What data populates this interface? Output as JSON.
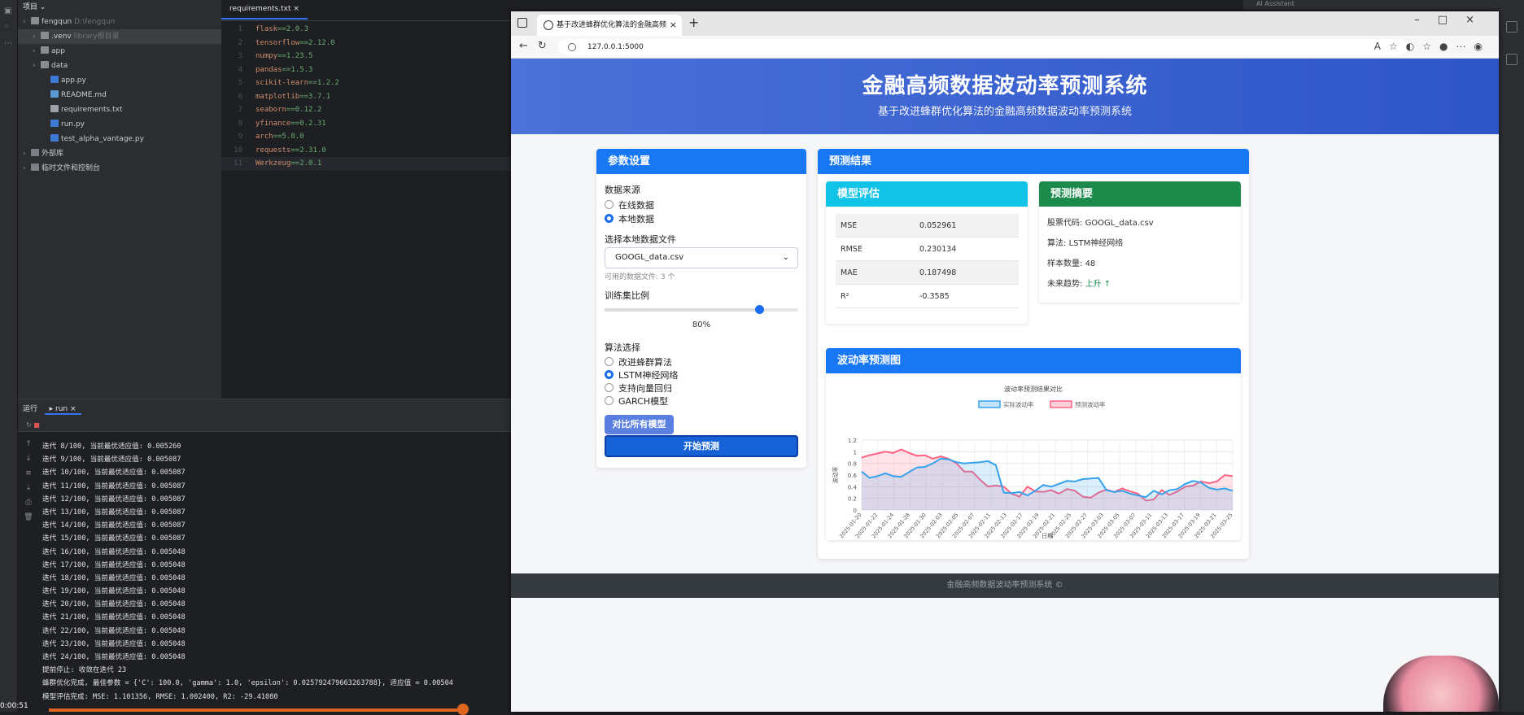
{
  "ide": {
    "project_header": "项目",
    "tree": [
      {
        "label": "fengqun",
        "hint": "D:\\fengqun",
        "indent": 0,
        "type": "folder"
      },
      {
        "label": ".venv",
        "hint": "library根目录",
        "indent": 1,
        "type": "folder",
        "selected": true
      },
      {
        "label": "app",
        "hint": "",
        "indent": 1,
        "type": "folder"
      },
      {
        "label": "data",
        "hint": "",
        "indent": 1,
        "type": "folder"
      },
      {
        "label": "app.py",
        "hint": "",
        "indent": 2,
        "type": "py"
      },
      {
        "label": "README.md",
        "hint": "",
        "indent": 2,
        "type": "md"
      },
      {
        "label": "requirements.txt",
        "hint": "",
        "indent": 2,
        "type": "txt"
      },
      {
        "label": "run.py",
        "hint": "",
        "indent": 2,
        "type": "py"
      },
      {
        "label": "test_alpha_vantage.py",
        "hint": "",
        "indent": 2,
        "type": "py"
      },
      {
        "label": "外部库",
        "hint": "",
        "indent": 0,
        "type": "lib"
      },
      {
        "label": "临时文件和控制台",
        "hint": "",
        "indent": 0,
        "type": "lib"
      }
    ],
    "editor_tab": "requirements.txt",
    "code": [
      {
        "n": "1",
        "pkg": "flask",
        "ver": "==2.0.3"
      },
      {
        "n": "2",
        "pkg": "tensorflow",
        "ver": "==2.12.0"
      },
      {
        "n": "3",
        "pkg": "numpy",
        "ver": "==1.23.5"
      },
      {
        "n": "4",
        "pkg": "pandas",
        "ver": "==1.5.3"
      },
      {
        "n": "5",
        "pkg": "scikit-learn",
        "ver": "==1.2.2"
      },
      {
        "n": "6",
        "pkg": "matplotlib",
        "ver": "==3.7.1"
      },
      {
        "n": "7",
        "pkg": "seaborn",
        "ver": "==0.12.2"
      },
      {
        "n": "8",
        "pkg": "yfinance",
        "ver": "==0.2.31"
      },
      {
        "n": "9",
        "pkg": "arch",
        "ver": "==5.0.0"
      },
      {
        "n": "10",
        "pkg": "requests",
        "ver": "==2.31.0"
      },
      {
        "n": "11",
        "pkg": "Werkzeug",
        "ver": "==2.0.1"
      }
    ],
    "run_header": "运行",
    "run_tab": "run",
    "console": [
      "迭代 8/100, 当前最优适应值: 0.005260",
      "迭代 9/100, 当前最优适应值: 0.005087",
      "迭代 10/100, 当前最优适应值: 0.005087",
      "迭代 11/100, 当前最优适应值: 0.005087",
      "迭代 12/100, 当前最优适应值: 0.005087",
      "迭代 13/100, 当前最优适应值: 0.005087",
      "迭代 14/100, 当前最优适应值: 0.005087",
      "迭代 15/100, 当前最优适应值: 0.005087",
      "迭代 16/100, 当前最优适应值: 0.005048",
      "迭代 17/100, 当前最优适应值: 0.005048",
      "迭代 18/100, 当前最优适应值: 0.005048",
      "迭代 19/100, 当前最优适应值: 0.005048",
      "迭代 20/100, 当前最优适应值: 0.005048",
      "迭代 21/100, 当前最优适应值: 0.005048",
      "迭代 22/100, 当前最优适应值: 0.005048",
      "迭代 23/100, 当前最优适应值: 0.005048",
      "迭代 24/100, 当前最优适应值: 0.005048",
      "提前停止: 收敛在迭代 23",
      "蜂群优化完成, 最佳参数 = {'C': 100.0, 'gamma': 1.0, 'epsilon': 0.025792479663263788}, 适应值 = 0.00504",
      "模型评估完成: MSE: 1.101356, RMSE: 1.002400, R2: -29.41080"
    ],
    "timestamp": "0:00:51",
    "top_right": "AI Assistant"
  },
  "browser": {
    "tab_title": "基于改进蜂群优化算法的金融高频",
    "url": "127.0.0.1:5000"
  },
  "page": {
    "title": "金融高频数据波动率预测系统",
    "subtitle": "基于改进蜂群优化算法的金融高频数据波动率预测系统",
    "params": {
      "header": "参数设置",
      "source_label": "数据来源",
      "source_online": "在线数据",
      "source_local": "本地数据",
      "file_label": "选择本地数据文件",
      "file_value": "GOOGL_data.csv",
      "file_hint": "可用的数据文件: 3 个",
      "ratio_label": "训练集比例",
      "ratio_value": "80%",
      "ratio_fraction": 0.8,
      "algo_label": "算法选择",
      "algos": [
        "改进蜂群算法",
        "LSTM神经网络",
        "支持向量回归",
        "GARCH模型"
      ],
      "selected_algo": 1,
      "compare_btn": "对比所有模型",
      "start_btn": "开始预测"
    },
    "results": {
      "header": "预测结果",
      "eval_header": "模型评估",
      "metrics": [
        {
          "k": "MSE",
          "v": "0.052961"
        },
        {
          "k": "RMSE",
          "v": "0.230134"
        },
        {
          "k": "MAE",
          "v": "0.187498"
        },
        {
          "k": "R²",
          "v": "-0.3585"
        }
      ],
      "summary_header": "预测摘要",
      "ticker_label": "股票代码: ",
      "ticker": "GOOGL_data.csv",
      "algo_label": "算法: ",
      "algo": "LSTM神经网络",
      "samples_label": "样本数量: ",
      "samples": "48",
      "trend_label": "未来趋势: ",
      "trend": "上升 ↑",
      "chart_header": "波动率预测图"
    },
    "footer": "金融高频数据波动率预测系统 ©"
  },
  "colors": {
    "actual": "#36a2eb",
    "predicted": "#ff6384",
    "accent": "#1877f2"
  },
  "chart_data": {
    "type": "area",
    "title": "波动率预测结果对比",
    "xlabel": "日期",
    "ylabel": "波动率",
    "ylim": [
      0,
      1.2
    ],
    "y_ticks": [
      "0",
      "0.2",
      "0.4",
      "0.6",
      "0.8",
      "1",
      "1.2"
    ],
    "legend_position": "top",
    "grid": true,
    "x_tick_labels": [
      "2025-01-20",
      "2025-01-22",
      "2025-01-24",
      "2025-01-28",
      "2025-01-30",
      "2025-02-03",
      "2025-02-05",
      "2025-02-07",
      "2025-02-11",
      "2025-02-13",
      "2025-02-17",
      "2025-02-19",
      "2025-02-21",
      "2025-02-25",
      "2025-02-27",
      "2025-03-03",
      "2025-03-05",
      "2025-03-07",
      "2025-03-11",
      "2025-03-13",
      "2025-03-17",
      "2025-03-19",
      "2025-03-21",
      "2025-03-25"
    ],
    "series": [
      {
        "name": "实际波动率",
        "color": "#36a2eb",
        "values": [
          0.66,
          0.55,
          0.58,
          0.63,
          0.58,
          0.57,
          0.65,
          0.73,
          0.74,
          0.8,
          0.88,
          0.87,
          0.82,
          0.8,
          0.81,
          0.82,
          0.84,
          0.77,
          0.3,
          0.29,
          0.31,
          0.25,
          0.33,
          0.43,
          0.4,
          0.45,
          0.5,
          0.49,
          0.53,
          0.54,
          0.55,
          0.34,
          0.31,
          0.33,
          0.28,
          0.25,
          0.22,
          0.33,
          0.27,
          0.34,
          0.36,
          0.45,
          0.5,
          0.47,
          0.38,
          0.35,
          0.37,
          0.33
        ]
      },
      {
        "name": "预测波动率",
        "color": "#ff6384",
        "values": [
          0.9,
          0.94,
          0.97,
          1.0,
          0.98,
          1.04,
          0.98,
          0.93,
          0.94,
          0.88,
          0.92,
          0.88,
          0.8,
          0.66,
          0.66,
          0.52,
          0.4,
          0.42,
          0.4,
          0.28,
          0.23,
          0.4,
          0.32,
          0.31,
          0.34,
          0.28,
          0.36,
          0.33,
          0.23,
          0.21,
          0.3,
          0.35,
          0.31,
          0.37,
          0.32,
          0.28,
          0.16,
          0.18,
          0.34,
          0.26,
          0.32,
          0.4,
          0.42,
          0.49,
          0.46,
          0.49,
          0.6,
          0.58
        ]
      }
    ]
  }
}
